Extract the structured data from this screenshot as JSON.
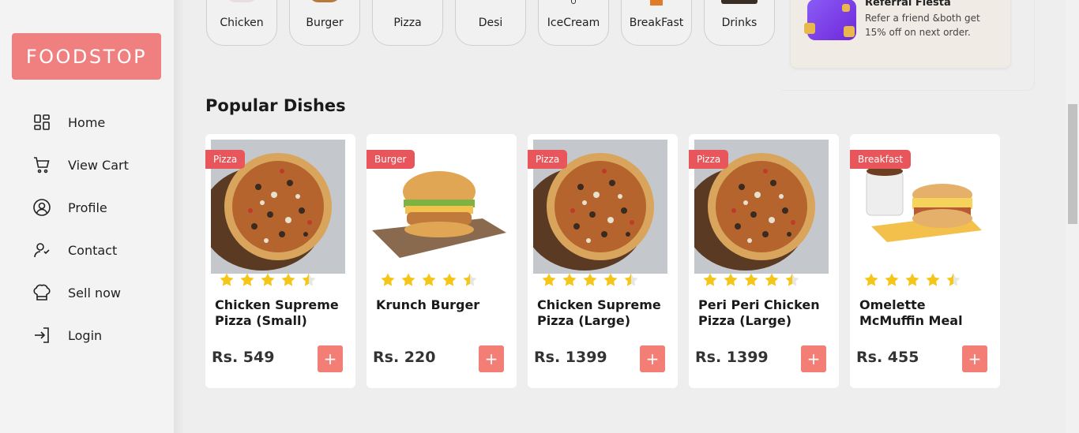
{
  "sidebar": {
    "logo": "FOODSTOP",
    "items": [
      {
        "label": "Home",
        "icon": "grid-icon"
      },
      {
        "label": "View Cart",
        "icon": "cart-icon"
      },
      {
        "label": "Profile",
        "icon": "user-circle-icon"
      },
      {
        "label": "Contact",
        "icon": "contact-icon"
      },
      {
        "label": "Sell now",
        "icon": "chef-hat-icon"
      },
      {
        "label": "Login",
        "icon": "login-icon"
      }
    ]
  },
  "categories": [
    "Chicken",
    "Burger",
    "Pizza",
    "Desi",
    "IceCream",
    "BreakFast",
    "Drinks"
  ],
  "referral": {
    "title": "Referral Fiesta",
    "text": "Refer a friend &both get 15% off on next order."
  },
  "section_title": "Popular Dishes",
  "dishes": [
    {
      "badge": "Pizza",
      "name": "Chicken Supreme Pizza (Small)",
      "price": "Rs. 549",
      "rating": 4.5,
      "image": "pizza"
    },
    {
      "badge": "Burger",
      "name": "Krunch Burger",
      "price": "Rs. 220",
      "rating": 4.5,
      "image": "burger"
    },
    {
      "badge": "Pizza",
      "name": "Chicken Supreme Pizza (Large)",
      "price": "Rs. 1399",
      "rating": 4.5,
      "image": "pizza"
    },
    {
      "badge": "Pizza",
      "name": "Peri Peri Chicken Pizza (Large)",
      "price": "Rs. 1399",
      "rating": 4.5,
      "image": "pizza"
    },
    {
      "badge": "Breakfast",
      "name": "Omelette McMuffin Meal",
      "price": "Rs. 455",
      "rating": 4.5,
      "image": "breakfast"
    }
  ],
  "add_label": "+",
  "colors": {
    "brand": "#f08080",
    "badge": "#e8555a",
    "add_button": "#f27e75",
    "star": "#f5c518"
  }
}
